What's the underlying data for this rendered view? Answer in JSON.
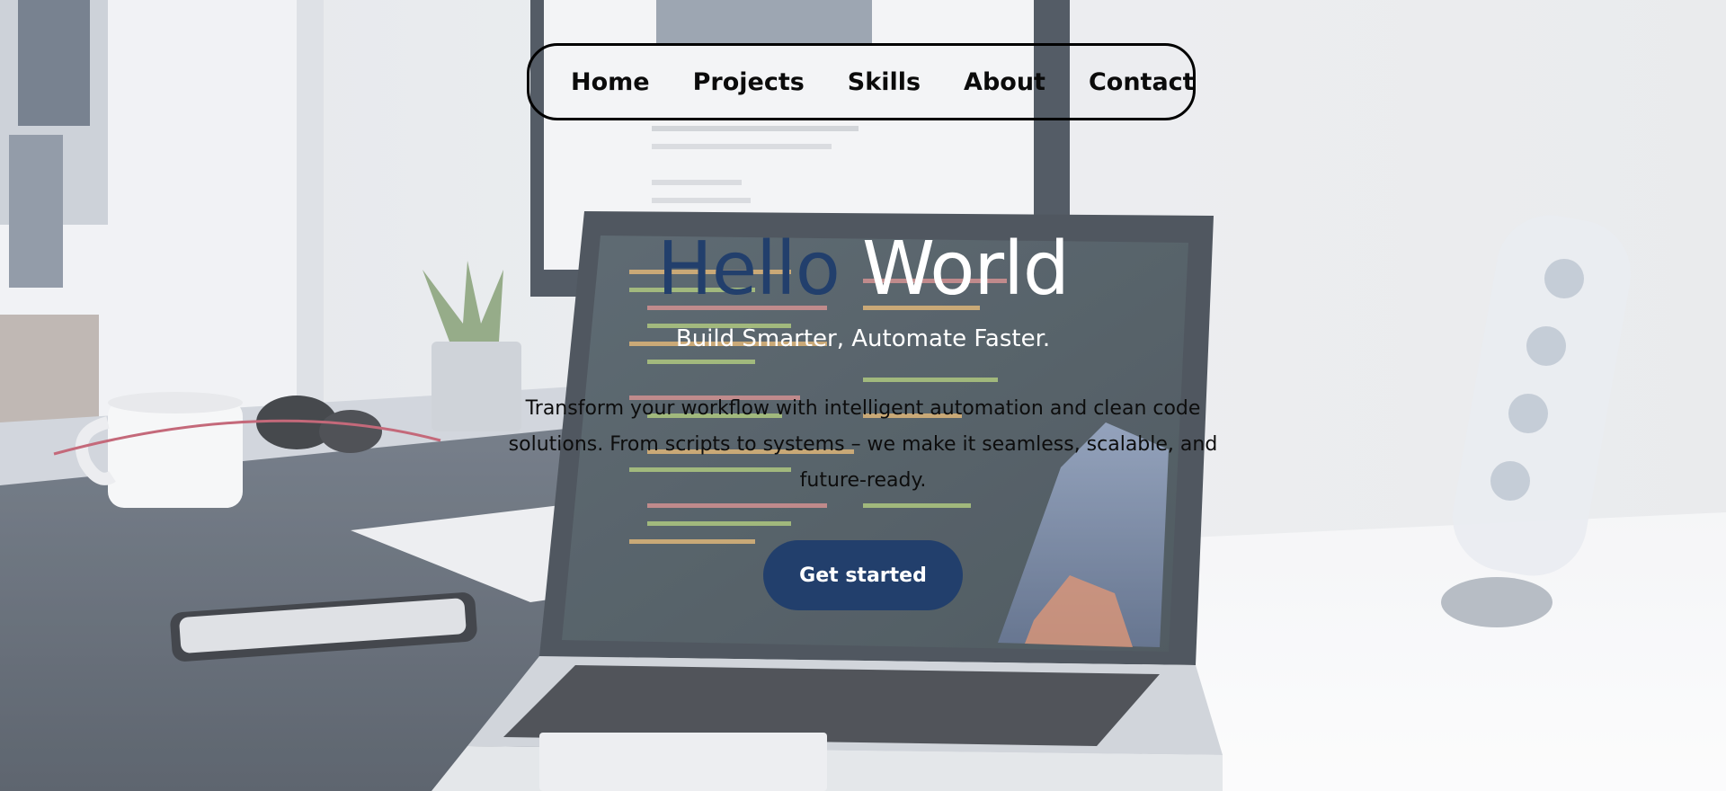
{
  "nav": {
    "items": [
      "Home",
      "Projects",
      "Skills",
      "About",
      "Contact"
    ]
  },
  "hero": {
    "headline_part1": "Hello",
    "headline_part2": "World",
    "subtitle": "Build Smarter, Automate Faster.",
    "description": "Transform your workflow with intelligent automation and clean code solutions. From scripts to systems – we make it seamless, scalable, and future-ready.",
    "cta_label": "Get started"
  },
  "colors": {
    "accent": "#223f6c",
    "headline_white": "#ffffff",
    "text_dark": "#0d0d0d"
  }
}
